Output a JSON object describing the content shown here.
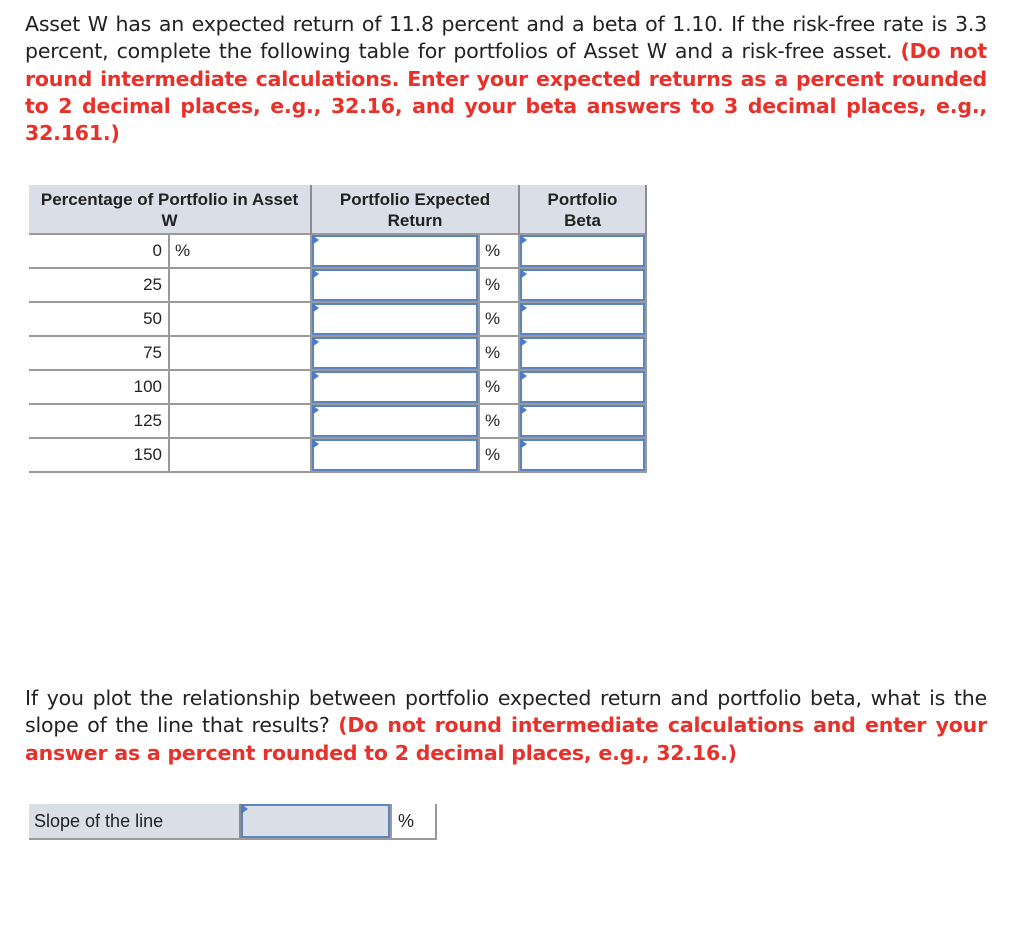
{
  "question1": {
    "text": "Asset W has an expected return of 11.8 percent and a beta of 1.10. If the risk-free rate is 3.3 percent, complete the following table for portfolios of Asset W and a risk-free asset.",
    "instruction": "(Do not round intermediate calculations. Enter your expected returns as a percent rounded to 2 decimal places, e.g., 32.16, and your beta answers to 3 decimal places, e.g., 32.161.)"
  },
  "table": {
    "headers": [
      "Percentage of Portfolio in Asset W",
      "Portfolio Expected Return",
      "Portfolio Beta"
    ],
    "unit_symbol": "%",
    "rows": [
      {
        "pct": "0",
        "pct_unit": "%",
        "return_value": "",
        "beta_value": ""
      },
      {
        "pct": "25",
        "pct_unit": "",
        "return_value": "",
        "beta_value": ""
      },
      {
        "pct": "50",
        "pct_unit": "",
        "return_value": "",
        "beta_value": ""
      },
      {
        "pct": "75",
        "pct_unit": "",
        "return_value": "",
        "beta_value": ""
      },
      {
        "pct": "100",
        "pct_unit": "",
        "return_value": "",
        "beta_value": ""
      },
      {
        "pct": "125",
        "pct_unit": "",
        "return_value": "",
        "beta_value": ""
      },
      {
        "pct": "150",
        "pct_unit": "",
        "return_value": "",
        "beta_value": ""
      }
    ]
  },
  "question2": {
    "text": "If you plot the relationship between portfolio expected return and portfolio beta, what is the slope of the line that results?",
    "instruction": "(Do not round intermediate calculations and enter your answer as a percent rounded to 2 decimal places, e.g., 32.16.)"
  },
  "slope": {
    "label": "Slope of the line",
    "value": "",
    "unit": "%"
  },
  "colors": {
    "instruction_red": "#e8312a",
    "header_bg": "#d9dee7",
    "input_border": "#5a84c4"
  }
}
